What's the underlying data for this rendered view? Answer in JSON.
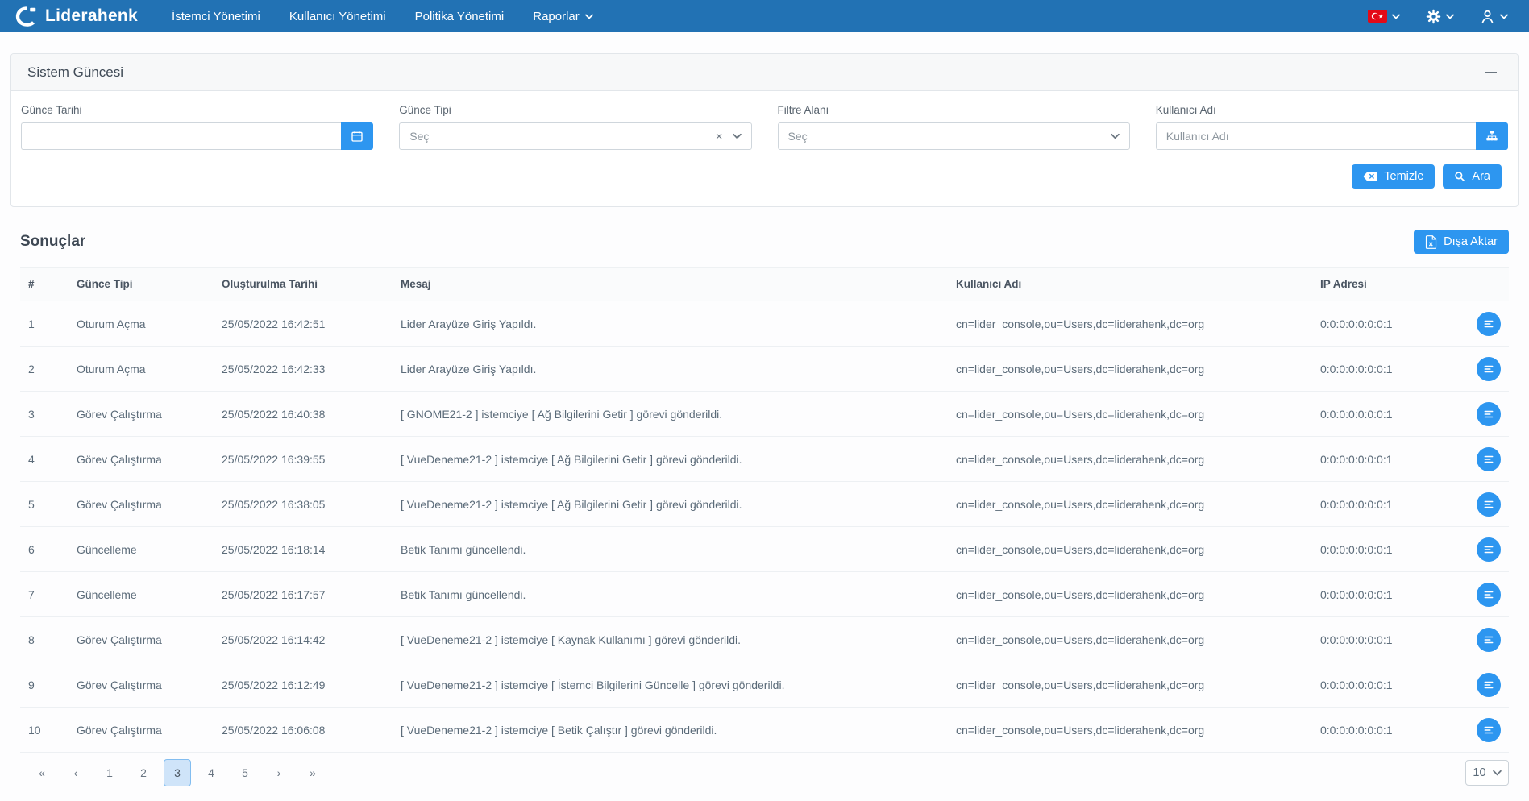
{
  "colors": {
    "navbar": "#2272b4",
    "accent": "#2d96f0",
    "flag_red": "#e30a17",
    "pagination_active_bg": "#cfe4f9",
    "pagination_active_border": "#82bdf0"
  },
  "navbar": {
    "brand": "Liderahenk",
    "items": [
      {
        "label": "İstemci Yönetimi"
      },
      {
        "label": "Kullanıcı Yönetimi"
      },
      {
        "label": "Politika Yönetimi"
      },
      {
        "label": "Raporlar"
      }
    ],
    "right_icons": [
      "turkey-flag-icon",
      "gear-icon",
      "user-icon"
    ]
  },
  "panel": {
    "title": "Sistem Güncesi",
    "collapse_icon": "minus-icon",
    "filters": {
      "date": {
        "label": "Günce Tarihi",
        "value": "",
        "button_icon": "calendar-icon"
      },
      "type": {
        "label": "Günce Tipi",
        "selected": "Seç",
        "clear_icon": "×"
      },
      "field": {
        "label": "Filtre Alanı",
        "selected": "Seç"
      },
      "username": {
        "label": "Kullanıcı Adı",
        "placeholder": "Kullanıcı Adı",
        "value": "",
        "button_icon": "sitemap-icon"
      }
    },
    "buttons": {
      "clear": "Temizle",
      "search": "Ara"
    }
  },
  "results": {
    "title": "Sonuçlar",
    "export_label": "Dışa Aktar",
    "table": {
      "headers": [
        "#",
        "Günce Tipi",
        "Oluşturulma Tarihi",
        "Mesaj",
        "Kullanıcı Adı",
        "IP Adresi"
      ],
      "rows": [
        [
          "1",
          "Oturum Açma",
          "25/05/2022 16:42:51",
          "Lider Arayüze Giriş Yapıldı.",
          "cn=lider_console,ou=Users,dc=liderahenk,dc=org",
          "0:0:0:0:0:0:0:1"
        ],
        [
          "2",
          "Oturum Açma",
          "25/05/2022 16:42:33",
          "Lider Arayüze Giriş Yapıldı.",
          "cn=lider_console,ou=Users,dc=liderahenk,dc=org",
          "0:0:0:0:0:0:0:1"
        ],
        [
          "3",
          "Görev Çalıştırma",
          "25/05/2022 16:40:38",
          "[ GNOME21-2 ] istemciye [ Ağ Bilgilerini Getir ] görevi gönderildi.",
          "cn=lider_console,ou=Users,dc=liderahenk,dc=org",
          "0:0:0:0:0:0:0:1"
        ],
        [
          "4",
          "Görev Çalıştırma",
          "25/05/2022 16:39:55",
          "[ VueDeneme21-2 ] istemciye [ Ağ Bilgilerini Getir ] görevi gönderildi.",
          "cn=lider_console,ou=Users,dc=liderahenk,dc=org",
          "0:0:0:0:0:0:0:1"
        ],
        [
          "5",
          "Görev Çalıştırma",
          "25/05/2022 16:38:05",
          "[ VueDeneme21-2 ] istemciye [ Ağ Bilgilerini Getir ] görevi gönderildi.",
          "cn=lider_console,ou=Users,dc=liderahenk,dc=org",
          "0:0:0:0:0:0:0:1"
        ],
        [
          "6",
          "Güncelleme",
          "25/05/2022 16:18:14",
          "Betik Tanımı güncellendi.",
          "cn=lider_console,ou=Users,dc=liderahenk,dc=org",
          "0:0:0:0:0:0:0:1"
        ],
        [
          "7",
          "Güncelleme",
          "25/05/2022 16:17:57",
          "Betik Tanımı güncellendi.",
          "cn=lider_console,ou=Users,dc=liderahenk,dc=org",
          "0:0:0:0:0:0:0:1"
        ],
        [
          "8",
          "Görev Çalıştırma",
          "25/05/2022 16:14:42",
          "[ VueDeneme21-2 ] istemciye [ Kaynak Kullanımı ] görevi gönderildi.",
          "cn=lider_console,ou=Users,dc=liderahenk,dc=org",
          "0:0:0:0:0:0:0:1"
        ],
        [
          "9",
          "Görev Çalıştırma",
          "25/05/2022 16:12:49",
          "[ VueDeneme21-2 ] istemciye [ İstemci Bilgilerini Güncelle ] görevi gönderildi.",
          "cn=lider_console,ou=Users,dc=liderahenk,dc=org",
          "0:0:0:0:0:0:0:1"
        ],
        [
          "10",
          "Görev Çalıştırma",
          "25/05/2022 16:06:08",
          "[ VueDeneme21-2 ] istemciye [ Betik Çalıştır ] görevi gönderildi.",
          "cn=lider_console,ou=Users,dc=liderahenk,dc=org",
          "0:0:0:0:0:0:0:1"
        ]
      ]
    },
    "pagination": {
      "items": [
        "«",
        "‹",
        "1",
        "2",
        "3",
        "4",
        "5",
        "›",
        "»"
      ],
      "active": "3",
      "page_size": "10"
    }
  }
}
